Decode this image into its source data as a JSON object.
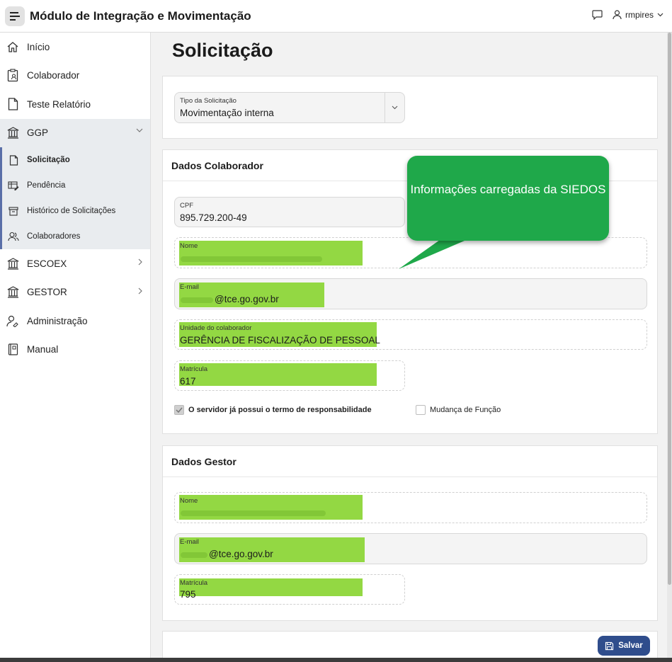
{
  "header": {
    "title": "Módulo de Integração e Movimentação",
    "user": "rmpires"
  },
  "sidebar": {
    "items": [
      {
        "label": "Início"
      },
      {
        "label": "Colaborador"
      },
      {
        "label": "Teste Relatório"
      },
      {
        "label": "GGP"
      },
      {
        "label": "ESCOEX"
      },
      {
        "label": "GESTOR"
      },
      {
        "label": "Administração"
      },
      {
        "label": "Manual"
      }
    ],
    "sub_items": [
      {
        "label": "Solicitação"
      },
      {
        "label": "Pendência"
      },
      {
        "label": "Histórico de Solicitações"
      },
      {
        "label": "Colaboradores"
      }
    ]
  },
  "page": {
    "title": "Solicitação"
  },
  "tipo": {
    "label": "Tipo da Solicitação",
    "value": "Movimentação interna"
  },
  "colaborador": {
    "heading": "Dados Colaborador",
    "cpf_label": "CPF",
    "cpf_value": "895.729.200-49",
    "nome_label": "Nome",
    "email_label": "E-mail",
    "email_value": "@tce.go.gov.br",
    "unidade_label": "Unidade do colaborador",
    "unidade_value": "GERÊNCIA DE FISCALIZAÇÃO DE PESSOAL",
    "matricula_label": "Matrícula",
    "matricula_value": "617",
    "termo_label": "O servidor já possui o termo de responsabilidade",
    "termo_checked": true,
    "mudanca_label": "Mudança de Função",
    "mudanca_checked": false
  },
  "gestor": {
    "heading": "Dados Gestor",
    "nome_label": "Nome",
    "email_label": "E-mail",
    "email_value": "@tce.go.gov.br",
    "matricula_label": "Matrícula",
    "matricula_value": "795"
  },
  "callout": {
    "text": "Informações carregadas da SIEDOS"
  },
  "actions": {
    "save_label": "Salvar"
  },
  "colors": {
    "highlight": "#93d843",
    "callout": "#1fa84a",
    "primary_button": "#2f4d8c",
    "submenu_accent": "#5a6fa8"
  }
}
